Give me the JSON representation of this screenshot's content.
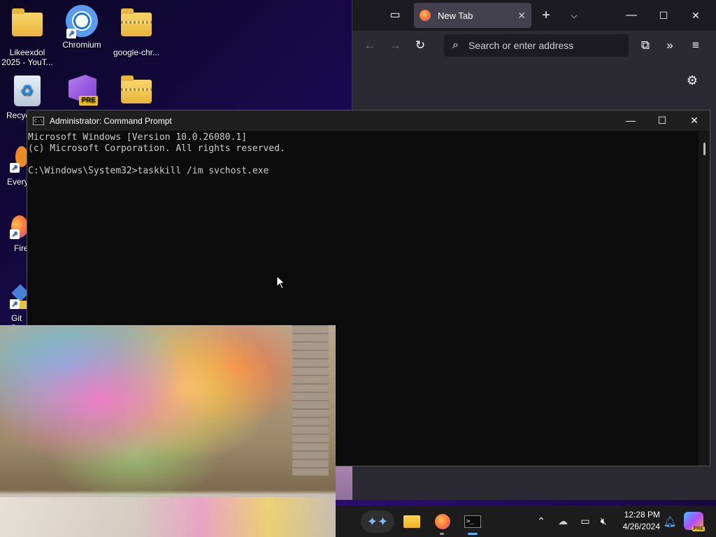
{
  "desktop": {
    "icons": [
      {
        "label": "Likeexdol 2025 - YouT...",
        "icon": "folder-icon"
      },
      {
        "label": "Chromium",
        "icon": "chromium-icon"
      },
      {
        "label": "google-chr...",
        "icon": "zip-folder-icon"
      },
      {
        "label": "Recyc",
        "icon": "recycle-bin-icon"
      },
      {
        "label": "",
        "icon": "visual-studio-preview-icon",
        "badge": "PRE"
      },
      {
        "label": "",
        "icon": "zip-folder-icon"
      },
      {
        "label": "Every",
        "icon": "everything-search-icon"
      },
      {
        "label": "Fire",
        "icon": "firefox-icon"
      },
      {
        "label": "Git B",
        "icon": "git-bash-icon"
      }
    ]
  },
  "firefox": {
    "tab_label": "New Tab",
    "address_placeholder": "Search or enter address"
  },
  "cmd": {
    "title": "Administrator: Command Prompt",
    "lines": [
      "Microsoft Windows [Version 10.0.26080.1]",
      "(c) Microsoft Corporation. All rights reserved.",
      "",
      "C:\\Windows\\System32>taskkill /im svchost.exe"
    ]
  },
  "taskbar": {
    "time": "12:28 PM",
    "date": "4/26/2024",
    "badge": "PRE"
  },
  "colors": {
    "accent": "#5ab0ff",
    "cmd_bg": "#0c0c0c",
    "firefox_chrome": "#2b2a33"
  }
}
